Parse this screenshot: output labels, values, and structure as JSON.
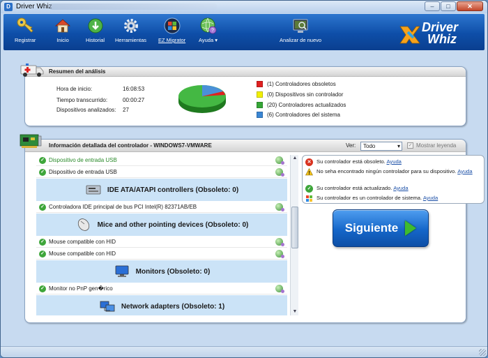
{
  "window": {
    "title": "Driver Whiz"
  },
  "toolbar": {
    "items": [
      {
        "label": "Registrar"
      },
      {
        "label": "Inicio"
      },
      {
        "label": "Historial"
      },
      {
        "label": "Herramientas"
      },
      {
        "label": "EZ Migrator"
      },
      {
        "label": "Ayuda"
      },
      {
        "label": "Analizar de nuevo"
      }
    ],
    "logo_line1": "Driver",
    "logo_line2": "Whiz"
  },
  "summary": {
    "title": "Resumen del análisis",
    "rows": [
      {
        "label": "Hora de inicio:",
        "value": "16:08:53"
      },
      {
        "label": "Tiempo transcurrido:",
        "value": "00:00:27"
      },
      {
        "label": "Dispositivos analizados:",
        "value": "27"
      }
    ],
    "legend": [
      {
        "label": "(1) Controladores obsoletos",
        "color": "#e02020"
      },
      {
        "label": "(0) Dispositivos sin controlador",
        "color": "#f2f000"
      },
      {
        "label": "(20) Controladores actualizados",
        "color": "#35a636"
      },
      {
        "label": "(6) Controladores del sistema",
        "color": "#3a86d4"
      }
    ]
  },
  "details": {
    "title": "Información detallada del controlador - WINDOWS7-VMWARE",
    "ver_label": "Ver:",
    "ver_value": "Todo",
    "legend_toggle": "Mostrar leyenda",
    "rows": [
      {
        "text": "Dispositivo de entrada USB"
      },
      {
        "text": "Dispositivo de entrada USB"
      },
      {
        "category": "IDE ATA/ATAPI controllers (Obsoleto: 0)"
      },
      {
        "text": "Controladora IDE principal de bus PCI Intel(R) 82371AB/EB"
      },
      {
        "category": "Mice and other pointing devices (Obsoleto: 0)"
      },
      {
        "text": "Mouse compatible con HID"
      },
      {
        "text": "Mouse compatible con HID"
      },
      {
        "category": "Monitors (Obsoleto: 0)"
      },
      {
        "text": "Monitor no PnP gen�rico"
      },
      {
        "category": "Network adapters (Obsoleto: 1)"
      }
    ],
    "status": {
      "obsolete": "Su controlador está obsoleto.",
      "missing": "No seha encontrado ningún controlador para su dispositivo.",
      "updated": "Su controlador está actualizado.",
      "system": "Su controlador es un controlador de sistema.",
      "help": "Ayuda"
    },
    "next_button": "Siguiente"
  }
}
